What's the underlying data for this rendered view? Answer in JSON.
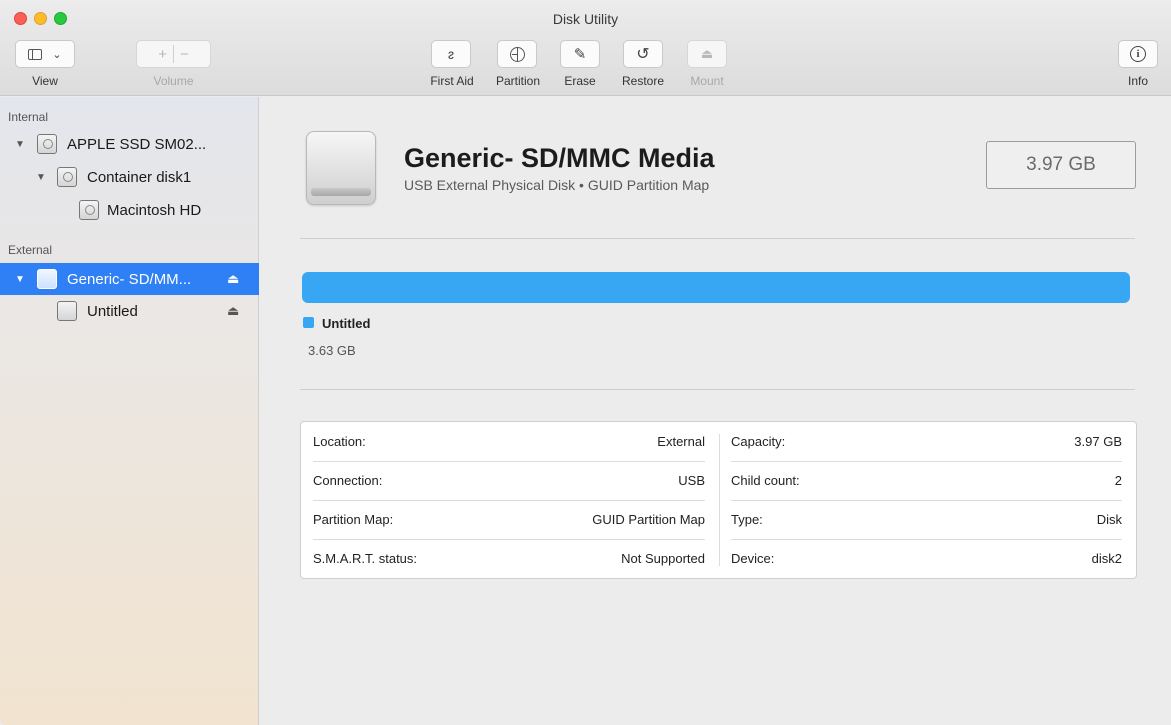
{
  "window": {
    "title": "Disk Utility"
  },
  "toolbar": {
    "view_label": "View",
    "volume_label": "Volume",
    "first_aid_label": "First Aid",
    "partition_label": "Partition",
    "erase_label": "Erase",
    "restore_label": "Restore",
    "mount_label": "Mount",
    "info_label": "Info"
  },
  "sidebar": {
    "internal_header": "Internal",
    "external_header": "External",
    "items": [
      {
        "label": "APPLE SSD SM02..."
      },
      {
        "label": "Container disk1"
      },
      {
        "label": "Macintosh HD"
      },
      {
        "label": "Generic- SD/MM..."
      },
      {
        "label": "Untitled"
      }
    ]
  },
  "main": {
    "disk_name": "Generic- SD/MMC Media",
    "disk_subtitle": "USB External Physical Disk • GUID Partition Map",
    "capacity": "3.97 GB",
    "legend": {
      "name": "Untitled",
      "size": "3.63 GB"
    },
    "info": {
      "left": [
        {
          "key": "Location:",
          "value": "External"
        },
        {
          "key": "Connection:",
          "value": "USB"
        },
        {
          "key": "Partition Map:",
          "value": "GUID Partition Map"
        },
        {
          "key": "S.M.A.R.T. status:",
          "value": "Not Supported"
        }
      ],
      "right": [
        {
          "key": "Capacity:",
          "value": "3.97 GB"
        },
        {
          "key": "Child count:",
          "value": "2"
        },
        {
          "key": "Type:",
          "value": "Disk"
        },
        {
          "key": "Device:",
          "value": "disk2"
        }
      ]
    }
  },
  "colors": {
    "selection": "#2f7ff5",
    "partition": "#38a7f3"
  }
}
